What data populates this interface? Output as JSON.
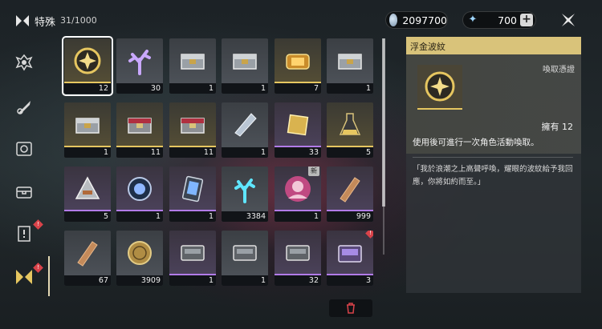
{
  "header": {
    "category_title": "特殊",
    "count": "31/1000"
  },
  "currencies": [
    {
      "name": "shell-credit",
      "value": "2097700"
    },
    {
      "name": "astrite",
      "value": "700"
    }
  ],
  "nav": {
    "items": [
      {
        "name": "echo-tab-icon",
        "badge": false
      },
      {
        "name": "weapon-tab-icon",
        "badge": false
      },
      {
        "name": "supply-tab-icon",
        "badge": false
      },
      {
        "name": "resource-tab-icon",
        "badge": false
      },
      {
        "name": "quest-item-tab-icon",
        "badge": true,
        "badge_text": "!"
      },
      {
        "name": "special-tab-icon",
        "badge": true,
        "badge_text": "!"
      }
    ]
  },
  "items": [
    {
      "qty": "12",
      "rarity": "gold",
      "icon": "golden-coin-emblem",
      "selected": true
    },
    {
      "qty": "30",
      "rarity": "grey",
      "icon": "crystal-coral"
    },
    {
      "qty": "1",
      "rarity": "grey",
      "icon": "silver-chest"
    },
    {
      "qty": "1",
      "rarity": "grey",
      "icon": "silver-chest"
    },
    {
      "qty": "7",
      "rarity": "gold",
      "icon": "golden-capsule"
    },
    {
      "qty": "1",
      "rarity": "grey",
      "icon": "silver-chest"
    },
    {
      "qty": "1",
      "rarity": "gold",
      "icon": "silver-chest"
    },
    {
      "qty": "11",
      "rarity": "gold",
      "icon": "red-chest"
    },
    {
      "qty": "11",
      "rarity": "gold",
      "icon": "red-chest"
    },
    {
      "qty": "1",
      "rarity": "grey",
      "icon": "crystal-shard"
    },
    {
      "qty": "33",
      "rarity": "purple",
      "icon": "golden-cube"
    },
    {
      "qty": "5",
      "rarity": "gold",
      "icon": "golden-flask"
    },
    {
      "qty": "5",
      "rarity": "purple",
      "icon": "triangle-device"
    },
    {
      "qty": "1",
      "rarity": "purple",
      "icon": "blue-orb"
    },
    {
      "qty": "1",
      "rarity": "purple",
      "icon": "card-device"
    },
    {
      "qty": "3384",
      "rarity": "grey",
      "icon": "cyan-coral"
    },
    {
      "qty": "1",
      "rarity": "purple",
      "icon": "character-portrait",
      "new": true,
      "new_label": "新"
    },
    {
      "qty": "999",
      "rarity": "purple",
      "icon": "wood-plank"
    },
    {
      "qty": "67",
      "rarity": "grey",
      "icon": "wood-plank"
    },
    {
      "qty": "3909",
      "rarity": "grey",
      "icon": "bronze-coin"
    },
    {
      "qty": "1",
      "rarity": "purple",
      "icon": "metal-case"
    },
    {
      "qty": "1",
      "rarity": "grey",
      "icon": "metal-case"
    },
    {
      "qty": "32",
      "rarity": "purple",
      "icon": "metal-case"
    },
    {
      "qty": "3",
      "rarity": "purple",
      "icon": "purple-case",
      "badge": true,
      "badge_text": "!"
    }
  ],
  "detail": {
    "name": "浮金波紋",
    "category": "喚取憑證",
    "owned": "擁有 12",
    "description": "使用後可進行一次角色活動喚取。",
    "lore": "「我於浪潮之上高聲呼喚，耀眼的波紋給予我回應，你將如約而至。」"
  },
  "colors": {
    "gold_accent": "#e6c660",
    "purple_accent": "#b27be8",
    "badge_red": "#d9434a"
  }
}
